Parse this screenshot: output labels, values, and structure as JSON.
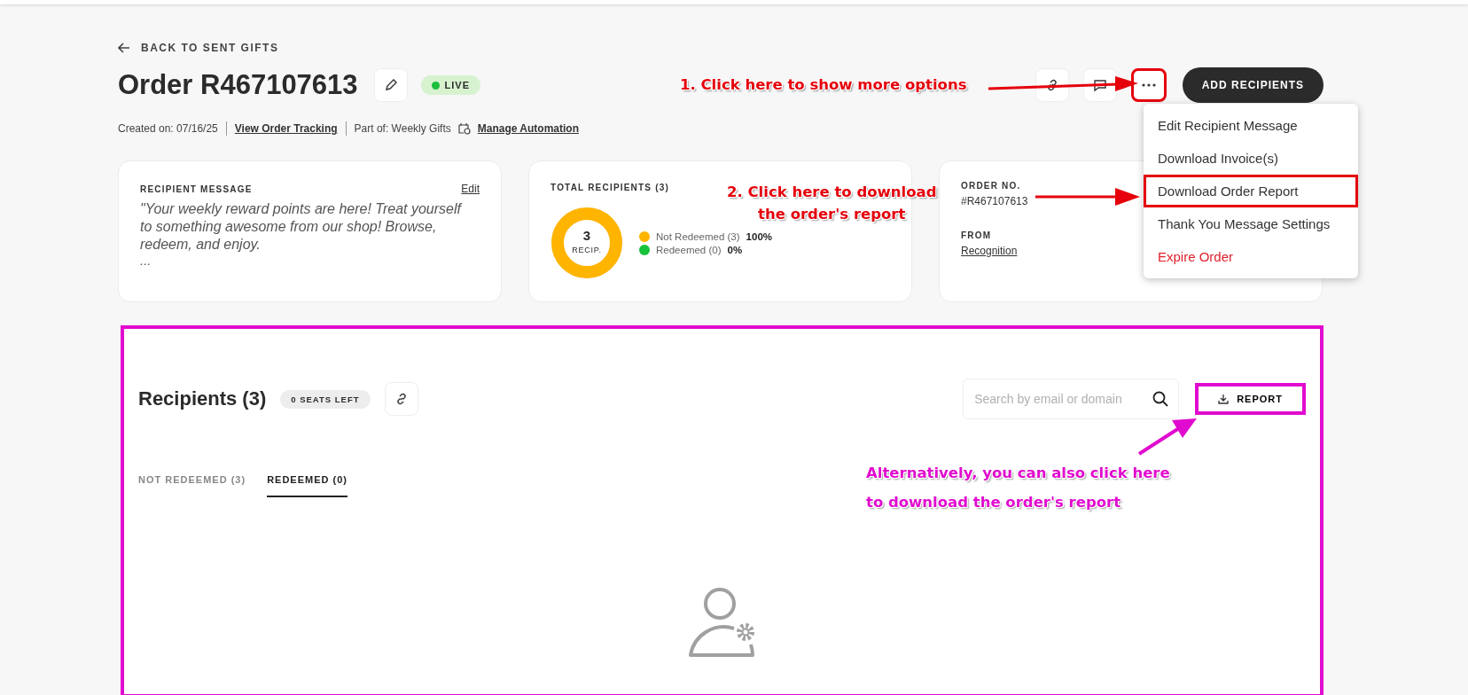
{
  "back_link": {
    "label": "BACK TO SENT GIFTS"
  },
  "order": {
    "title": "Order R467107613",
    "status": "LIVE"
  },
  "meta": {
    "created": "Created on: 07/16/25",
    "tracking_link": "View Order Tracking",
    "part_of": "Part of: Weekly Gifts",
    "automation_link": "Manage Automation"
  },
  "header_actions": {
    "add_button": "ADD RECIPIENTS",
    "more_button_highlighted": true
  },
  "more_menu": {
    "items": [
      {
        "label": "Edit Recipient Message",
        "kind": "normal",
        "highlighted": false
      },
      {
        "label": "Download Invoice(s)",
        "kind": "normal",
        "highlighted": false
      },
      {
        "label": "Download Order Report",
        "kind": "normal",
        "highlighted": true
      },
      {
        "label": "Thank You Message Settings",
        "kind": "normal",
        "highlighted": false
      },
      {
        "label": "Expire Order",
        "kind": "danger",
        "highlighted": false
      }
    ]
  },
  "message_card": {
    "heading": "RECIPIENT MESSAGE",
    "edit_link": "Edit",
    "message": "\"Your weekly reward points are here! Treat yourself to something awesome from our shop! Browse, redeem, and enjoy.",
    "ellipsis": "..."
  },
  "recipients_card": {
    "heading": "TOTAL RECIPIENTS (3)",
    "donut_count": "3",
    "donut_label": "RECIP.",
    "legend": [
      {
        "label": "Not Redeemed (3)",
        "percent": "100%",
        "color": "#ffb400",
        "level": 1
      },
      {
        "label": "Redeemed (0)",
        "percent": "0%",
        "color": "#18c23a",
        "level": 0
      }
    ]
  },
  "order_card": {
    "fields": [
      {
        "label": "ORDER NO.",
        "value": "#R467107613",
        "kind": "text"
      },
      {
        "label": "FROM",
        "value": "Recognition",
        "kind": "link"
      }
    ]
  },
  "recipients": {
    "panel_highlighted": true,
    "report_highlighted": true,
    "title": "Recipients (3)",
    "seats_badge": "0 SEATS LEFT",
    "search": {
      "placeholder": "Search by email or domain"
    },
    "report_button": "REPORT",
    "tabs": [
      {
        "label": "NOT REDEEMED (3)",
        "selected": false
      },
      {
        "label": "REDEEMED (0)",
        "selected": true
      }
    ]
  },
  "annotations": [
    {
      "text": "1. Click here to show more options",
      "color": "#e5000b"
    },
    {
      "text": "2. Click here to download\nthe order's report",
      "color": "#e5000b"
    },
    {
      "text": "Alternatively, you can also click here\nto download the order's report",
      "color": "#e10bcf"
    }
  ]
}
